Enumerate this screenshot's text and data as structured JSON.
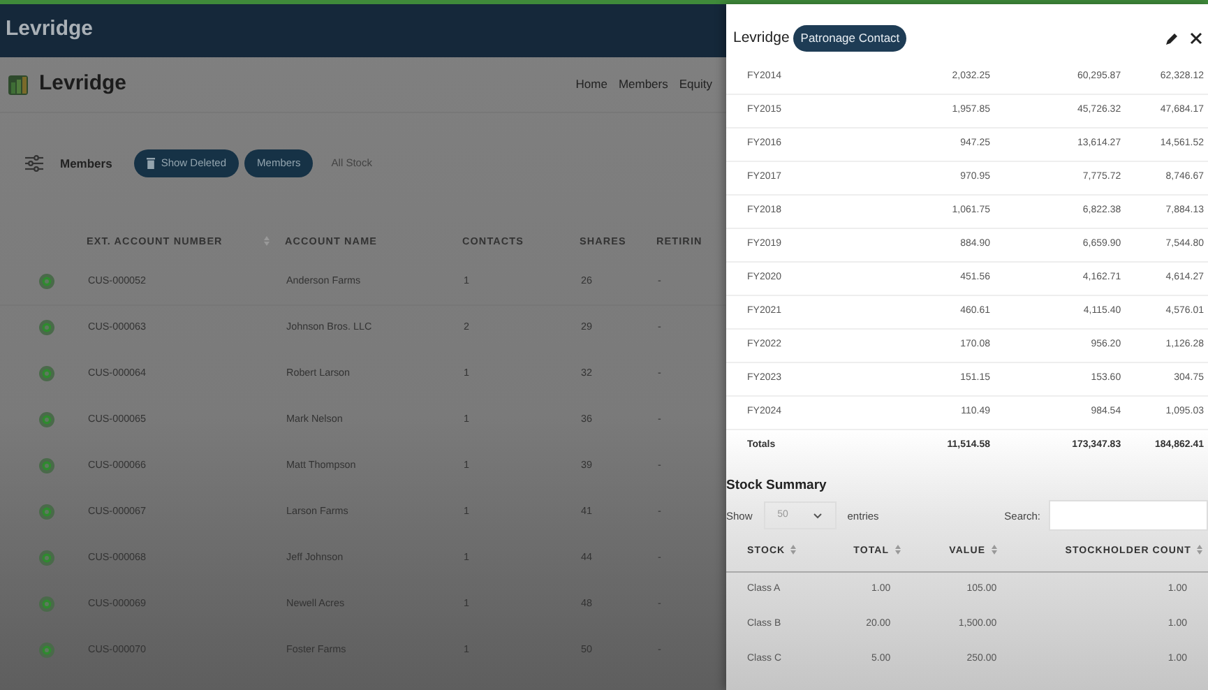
{
  "app_header": {
    "title": "Levridge"
  },
  "navbar": {
    "brand": "Levridge",
    "links": [
      "Home",
      "Members",
      "Equity"
    ]
  },
  "toolbar": {
    "label": "Members",
    "filters": [
      {
        "label": "Show Deleted",
        "kind": "trash",
        "selected": true
      },
      {
        "label": "Members",
        "kind": "plain",
        "selected": true
      },
      {
        "label": "All Stock",
        "kind": "plain",
        "selected": false
      }
    ]
  },
  "members_table": {
    "columns": [
      "EXT. ACCOUNT NUMBER",
      "ACCOUNT NAME",
      "CONTACTS",
      "SHARES",
      "RETIRIN"
    ],
    "rows": [
      {
        "cells": [
          "CUS-000052",
          "Anderson Farms",
          "1",
          "26",
          "-"
        ]
      },
      {
        "cells": [
          "CUS-000063",
          "Johnson Bros. LLC",
          "2",
          "29",
          "-"
        ]
      },
      {
        "cells": [
          "CUS-000064",
          "Robert Larson",
          "1",
          "32",
          "-"
        ]
      },
      {
        "cells": [
          "CUS-000065",
          "Mark Nelson",
          "1",
          "36",
          "-"
        ]
      },
      {
        "cells": [
          "CUS-000066",
          "Matt Thompson",
          "1",
          "39",
          "-"
        ]
      },
      {
        "cells": [
          "CUS-000067",
          "Larson Farms",
          "1",
          "41",
          "-"
        ]
      },
      {
        "cells": [
          "CUS-000068",
          "Jeff Johnson",
          "1",
          "44",
          "-"
        ]
      },
      {
        "cells": [
          "CUS-000069",
          "Newell Acres",
          "1",
          "48",
          "-"
        ]
      },
      {
        "cells": [
          "CUS-000070",
          "Foster Farms",
          "1",
          "50",
          "-"
        ]
      }
    ]
  },
  "panel": {
    "title": "Levridge",
    "badge": "Patronage Contact",
    "patronage_rows": [
      [
        "FY2014",
        "2,032.25",
        "60,295.87",
        "62,328.12"
      ],
      [
        "FY2015",
        "1,957.85",
        "45,726.32",
        "47,684.17"
      ],
      [
        "FY2016",
        "947.25",
        "13,614.27",
        "14,561.52"
      ],
      [
        "FY2017",
        "970.95",
        "7,775.72",
        "8,746.67"
      ],
      [
        "FY2018",
        "1,061.75",
        "6,822.38",
        "7,884.13"
      ],
      [
        "FY2019",
        "884.90",
        "6,659.90",
        "7,544.80"
      ],
      [
        "FY2020",
        "451.56",
        "4,162.71",
        "4,614.27"
      ],
      [
        "FY2021",
        "460.61",
        "4,115.40",
        "4,576.01"
      ],
      [
        "FY2022",
        "170.08",
        "956.20",
        "1,126.28"
      ],
      [
        "FY2023",
        "151.15",
        "153.60",
        "304.75"
      ],
      [
        "FY2024",
        "110.49",
        "984.54",
        "1,095.03"
      ]
    ],
    "totals": [
      "Totals",
      "11,514.58",
      "173,347.83",
      "184,862.41"
    ],
    "stock_summary": {
      "title": "Stock Summary",
      "show_label": "Show",
      "page_size": "50",
      "entries_label": "entries",
      "search_label": "Search:",
      "columns": [
        "STOCK",
        "TOTAL",
        "VALUE",
        "STOCKHOLDER COUNT"
      ],
      "rows": [
        [
          "Class A",
          "1.00",
          "105.00",
          "1.00"
        ],
        [
          "Class B",
          "20.00",
          "1,500.00",
          "1.00"
        ],
        [
          "Class C",
          "5.00",
          "250.00",
          "1.00"
        ]
      ]
    }
  }
}
